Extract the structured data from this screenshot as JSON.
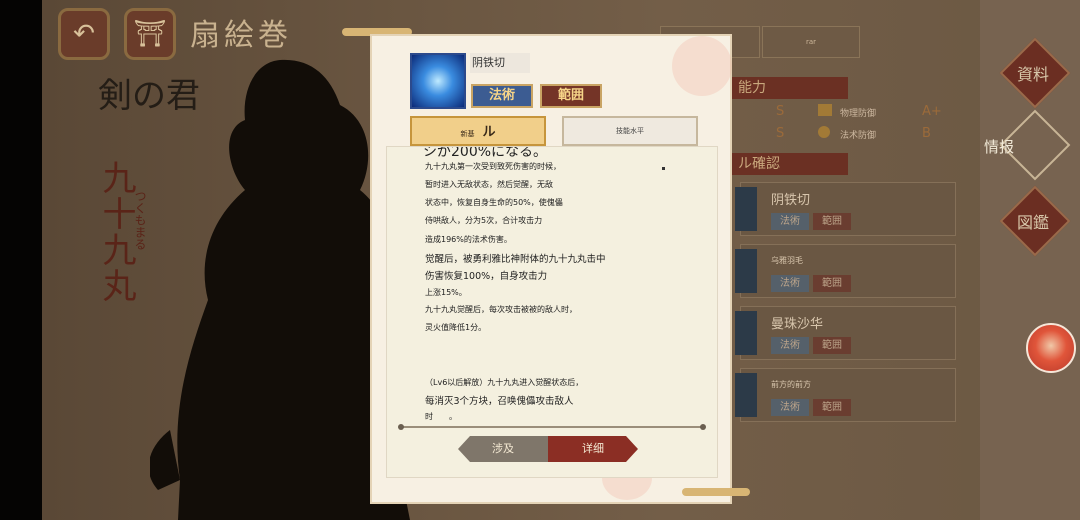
{
  "header": {
    "title": "扇絵巻",
    "back_icon": "back-arrow-icon",
    "home_icon": "shrine-gate-icon"
  },
  "character": {
    "name_vertical": "剣の君",
    "red_title": "九十九丸",
    "red_ruby": "つくもまる"
  },
  "right_panel": {
    "tab2_label": "rar",
    "section_ability": "能力",
    "section_confirm": "ル確認",
    "stats": [
      {
        "grade": "S"
      },
      {
        "grade": "S"
      },
      {
        "label": "物理防御",
        "grade": "A+"
      },
      {
        "label": "法术防御",
        "grade": "B"
      }
    ],
    "cards": [
      {
        "name": "阴铁切",
        "chip_a": "法術",
        "chip_b": "範囲"
      },
      {
        "name": "乌雅羽毛",
        "chip_a": "法術",
        "chip_b": "範囲"
      },
      {
        "name": "曼珠沙华",
        "chip_a": "法術",
        "chip_b": "範囲"
      },
      {
        "name": "前方的前方",
        "chip_a": "法術",
        "chip_b": "範囲"
      }
    ]
  },
  "side_menu": {
    "item1": "資料",
    "item2": "情报",
    "item3": "図鑑"
  },
  "modal": {
    "skill_name": "阴铁切",
    "tag_magic": "法術",
    "tag_range": "範囲",
    "subtab1_prefix": "新基",
    "subtab1_label": "ル",
    "subtab2_label": "技能水平",
    "cut_line": "シが200%になる。",
    "lines": [
      "九十九丸第一次受到致死伤害的时候，",
      "暂时进入无敌状态，然后觉醒，无敌",
      "状态中，恢复自身生命的50%，使傀儡",
      "侍哄敌人，分为5次，合计攻击力",
      "造成196%的法术伤害。",
      "觉醒后，被勇利雅比神附体的九十九丸击中",
      "伤害恢复100%，自身攻击力",
      "上涨15%。",
      "九十九丸觉醒后，每次攻击被被的敌人时，",
      "灵火值降低1分。",
      "（Lv6以后解放）九十九丸进入觉醒状态后，",
      "每消灭3个方块，召唤傀儡攻击敌人",
      "时　　。"
    ],
    "button_left": "涉及",
    "button_right": "详细"
  }
}
